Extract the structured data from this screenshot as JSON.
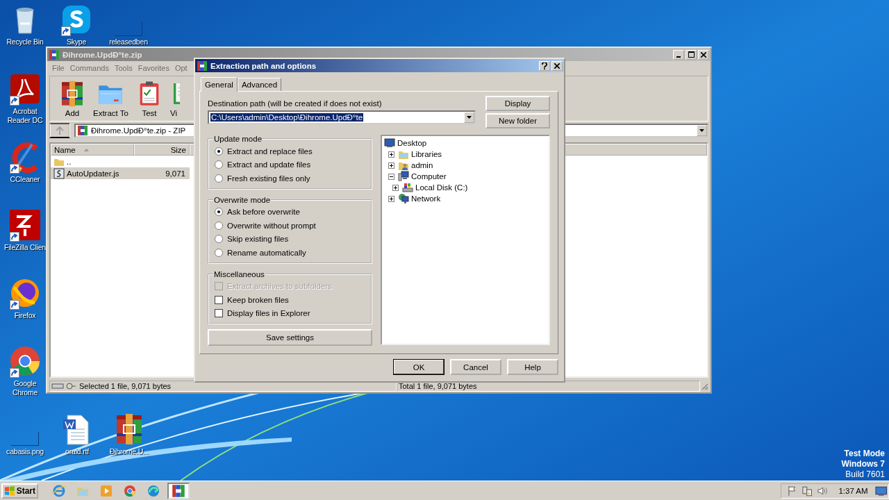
{
  "desktop": {
    "icons": [
      {
        "label": "Recycle Bin",
        "shortcut": false
      },
      {
        "label": "Skype",
        "shortcut": true
      },
      {
        "label": "releasedben",
        "shortcut": false
      },
      {
        "label": "Acrobat Reader DC",
        "shortcut": true
      },
      {
        "label": "CCleaner",
        "shortcut": true
      },
      {
        "label": "FileZilla Clien",
        "shortcut": true
      },
      {
        "label": "Firefox",
        "shortcut": true
      },
      {
        "label": "Google Chrome",
        "shortcut": true
      },
      {
        "label": "cabasis.png",
        "shortcut": false
      },
      {
        "label": "oraid.rtf",
        "shortcut": false
      },
      {
        "label": "Đihrome.U...",
        "shortcut": false
      }
    ]
  },
  "archive_window": {
    "title": "Đihrome.UpdÐ°te.zip",
    "menu": [
      "File",
      "Commands",
      "Tools",
      "Favorites",
      "Opt"
    ],
    "toolbar": [
      "Add",
      "Extract To",
      "Test",
      "Vi"
    ],
    "address": "Đihrome.UpdÐ°te.zip - ZIP",
    "columns": [
      "Name",
      "Size"
    ],
    "rows": [
      {
        "name": "..",
        "selected": false
      },
      {
        "name": "AutoUpdater.js",
        "size": "9,071",
        "selected": true
      }
    ],
    "status_left": "Selected 1 file, 9,071 bytes",
    "status_right": "Total 1 file, 9,071 bytes"
  },
  "dialog": {
    "title": "Extraction path and options",
    "tabs": [
      {
        "label": "General",
        "selected": true
      },
      {
        "label": "Advanced",
        "selected": false
      }
    ],
    "destination_label": "Destination path (will be created if does not exist)",
    "destination_value": "C:\\Users\\admin\\Desktop\\Đihrome.UpdÐ°te",
    "value_selected": true,
    "side_buttons": [
      "Display",
      "New folder"
    ],
    "groups": [
      {
        "title": "Update mode",
        "kind": "radio",
        "options": [
          {
            "label": "Extract and replace files",
            "selected": true
          },
          {
            "label": "Extract and update files",
            "selected": false
          },
          {
            "label": "Fresh existing files only",
            "selected": false
          }
        ]
      },
      {
        "title": "Overwrite mode",
        "kind": "radio",
        "options": [
          {
            "label": "Ask before overwrite",
            "selected": true
          },
          {
            "label": "Overwrite without prompt",
            "selected": false
          },
          {
            "label": "Skip existing files",
            "selected": false
          },
          {
            "label": "Rename automatically",
            "selected": false
          }
        ]
      },
      {
        "title": "Miscellaneous",
        "kind": "checkbox",
        "options": [
          {
            "label": "Extract archives to subfolders",
            "checked": false,
            "disabled": true
          },
          {
            "label": "Keep broken files",
            "checked": false,
            "disabled": false
          },
          {
            "label": "Display files in Explorer",
            "checked": false,
            "disabled": false
          }
        ]
      }
    ],
    "save_button": "Save settings",
    "tree": [
      {
        "label": "Desktop",
        "children": [
          {
            "label": "Libraries",
            "expanded": false
          },
          {
            "label": "admin",
            "expanded": false
          },
          {
            "label": "Computer",
            "expanded": true,
            "children": [
              {
                "label": "Local Disk (C:)",
                "expanded": false
              }
            ]
          },
          {
            "label": "Network",
            "expanded": false
          }
        ]
      }
    ],
    "buttons": [
      {
        "label": "OK",
        "default": true
      },
      {
        "label": "Cancel",
        "default": false
      },
      {
        "label": "Help",
        "default": false
      }
    ]
  },
  "os_notice": [
    {
      "text": "Test Mode",
      "bold": true
    },
    {
      "text": "Windows 7",
      "bold": true
    },
    {
      "text": "Build 7601",
      "bold": false
    }
  ],
  "taskbar": {
    "start": "Start",
    "apps": [
      {
        "active": false
      },
      {
        "active": false
      },
      {
        "active": false
      },
      {
        "active": false
      },
      {
        "active": false
      },
      {
        "active": true
      }
    ],
    "clock": "1:37 AM"
  }
}
